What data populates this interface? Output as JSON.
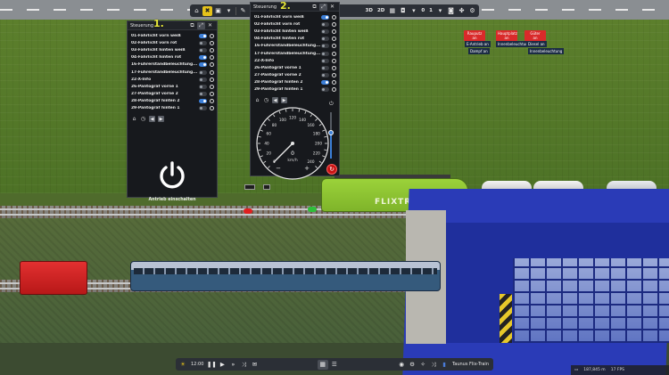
{
  "toolbar": {
    "items": [
      {
        "icon": "home-icon"
      },
      {
        "icon": "tools-icon",
        "active": true
      },
      {
        "icon": "save-icon"
      },
      {
        "icon": "layers-icon"
      },
      {
        "icon": "info-icon"
      },
      {
        "icon": "camera-icon"
      }
    ],
    "view_3d": "3D",
    "view_2d": "2D",
    "counter_left": "0",
    "counter_right": "1"
  },
  "panel1": {
    "title": "Steuerung",
    "badge": "1.",
    "functions": [
      {
        "label": "01-Fahrlicht vorn weiß",
        "on": true
      },
      {
        "label": "02-Fahrlicht vorn rot",
        "on": false
      },
      {
        "label": "03-Fahrlicht hinten weiß",
        "on": false
      },
      {
        "label": "04-Fahrlicht hinten rot",
        "on": true
      },
      {
        "label": "16-Führerstandbeleuchtung...",
        "on": true
      },
      {
        "label": "17-Führerstandbeleuchtung...",
        "on": false
      },
      {
        "label": "22-X-Info",
        "on": false
      },
      {
        "label": "26-Pantograf vorne 1",
        "on": false
      },
      {
        "label": "27-Pantograf vorne 2",
        "on": false
      },
      {
        "label": "28-Pantograf hinten 2",
        "on": true
      },
      {
        "label": "29-Pantograf hinten 1",
        "on": false
      }
    ],
    "power_label": "Antrieb einschalten"
  },
  "panel2": {
    "title": "Steuerung",
    "badge": "2.",
    "functions": [
      {
        "label": "01-Fahrlicht vorn weiß",
        "on": true
      },
      {
        "label": "02-Fahrlicht vorn rot",
        "on": false
      },
      {
        "label": "03-Fahrlicht hinten weiß",
        "on": false
      },
      {
        "label": "04-Fahrlicht hinten rot",
        "on": false
      },
      {
        "label": "16-Führerstandbeleuchtung...",
        "on": false
      },
      {
        "label": "17-Führerstandbeleuchtung...",
        "on": false
      },
      {
        "label": "22-X-Info",
        "on": false
      },
      {
        "label": "26-Pantograf vorne 1",
        "on": false
      },
      {
        "label": "27-Pantograf vorne 2",
        "on": false
      },
      {
        "label": "28-Pantograf hinten 2",
        "on": true
      },
      {
        "label": "29-Pantograf hinten 1",
        "on": false
      }
    ],
    "speedometer": {
      "ticks": [
        "0",
        "10",
        "20",
        "30",
        "40",
        "50",
        "60",
        "70",
        "80",
        "90",
        "100",
        "110",
        "120",
        "130",
        "140",
        "150",
        "160",
        "170",
        "180",
        "190",
        "200",
        "210",
        "220",
        "230",
        "240"
      ],
      "value": "0",
      "unit": "km/h",
      "minus": "−",
      "plus": "+",
      "needle_kmh": 0
    },
    "throttle_level": 0.55
  },
  "signs": {
    "top_left": "Rauputz\nan",
    "top_mid": "Hauptplatz\nan",
    "top_right": "Güter\nan",
    "sub1": "E-Antrieb an",
    "sub2": "Innenbeleuchtung",
    "sub3": "Diesel an",
    "sub4": "Dampf an",
    "sub5": "Innenbeleuchtung"
  },
  "loco_text": "FLIXTRAIN",
  "bottom_bar": {
    "time": "12:00",
    "train_name": "Taunus Flix-Train"
  },
  "status": {
    "coords": "187,845 m",
    "fps": "17 FPS"
  },
  "colors": {
    "accent": "#e6c21a",
    "toggle_on": "#3c7fd8",
    "badge": "#e8e83a",
    "reset": "#c81414"
  }
}
